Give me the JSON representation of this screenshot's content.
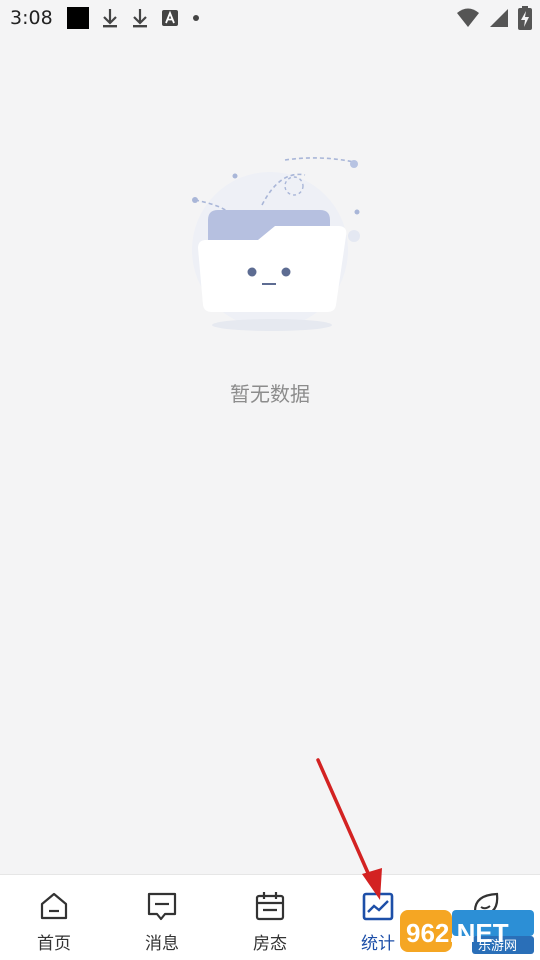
{
  "status_bar": {
    "time": "3:08",
    "icons": [
      "black-square-icon",
      "download-icon",
      "download-icon",
      "text-a-icon",
      "dot-icon",
      "wifi-icon",
      "signal-icon",
      "battery-charging-icon"
    ]
  },
  "empty_state": {
    "message": "暂无数据",
    "icon": "empty-folder-illustration"
  },
  "bottom_nav": {
    "items": [
      {
        "label": "首页",
        "icon": "home-icon",
        "active": false
      },
      {
        "label": "消息",
        "icon": "message-icon",
        "active": false
      },
      {
        "label": "房态",
        "icon": "calendar-icon",
        "active": false
      },
      {
        "label": "统计",
        "icon": "chart-icon",
        "active": true
      },
      {
        "label": "",
        "icon": "leaf-icon",
        "active": false
      }
    ]
  },
  "watermark": {
    "brand": "962.NET",
    "subtitle": "乐游网"
  },
  "colors": {
    "background": "#f4f4f5",
    "accent": "#1d4fa8",
    "annotation": "#d32222"
  }
}
